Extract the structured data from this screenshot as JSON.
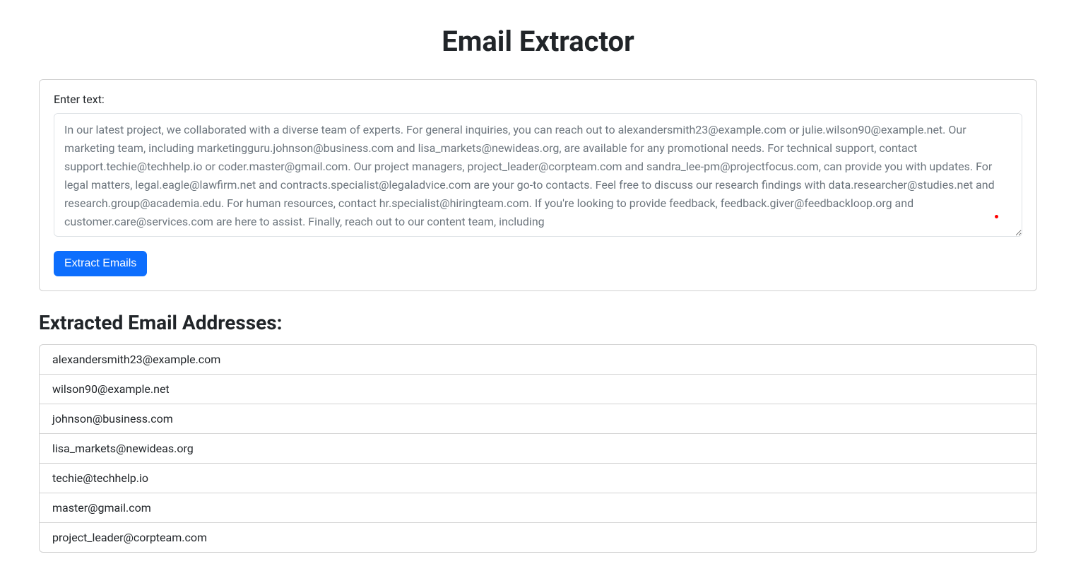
{
  "title": "Email Extractor",
  "form": {
    "label": "Enter text:",
    "textarea_value": "In our latest project, we collaborated with a diverse team of experts. For general inquiries, you can reach out to alexandersmith23@example.com or julie.wilson90@example.net. Our marketing team, including marketingguru.johnson@business.com and lisa_markets@newideas.org, are available for any promotional needs. For technical support, contact support.techie@techhelp.io or coder.master@gmail.com. Our project managers, project_leader@corpteam.com and sandra_lee-pm@projectfocus.com, can provide you with updates. For legal matters, legal.eagle@lawfirm.net and contracts.specialist@legaladvice.com are your go-to contacts. Feel free to discuss our research findings with data.researcher@studies.net and research.group@academia.edu. For human resources, contact hr.specialist@hiringteam.com. If you're looking to provide feedback, feedback.giver@feedbackloop.org and customer.care@services.com are here to assist. Finally, reach out to our content team, including",
    "button_label": "Extract Emails"
  },
  "results": {
    "heading": "Extracted Email Addresses:",
    "emails": [
      "alexandersmith23@example.com",
      "wilson90@example.net",
      "johnson@business.com",
      "lisa_markets@newideas.org",
      "techie@techhelp.io",
      "master@gmail.com",
      "project_leader@corpteam.com"
    ]
  }
}
